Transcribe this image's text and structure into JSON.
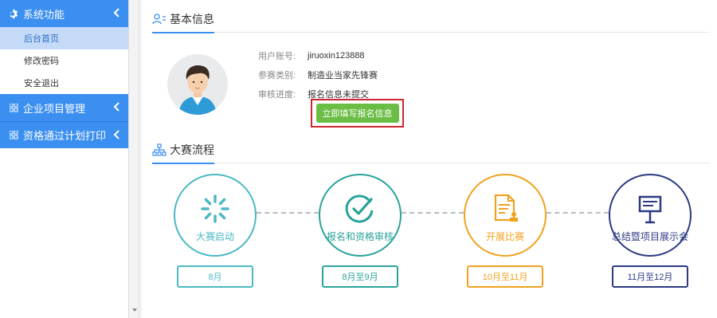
{
  "sidebar": {
    "groups": [
      {
        "label": "系统功能",
        "icon": "gear-icon",
        "items": [
          {
            "label": "后台首页",
            "active": true
          },
          {
            "label": "修改密码",
            "active": false
          },
          {
            "label": "安全退出",
            "active": false
          }
        ]
      },
      {
        "label": "企业项目管理",
        "icon": "grid-icon",
        "items": []
      },
      {
        "label": "资格通过计划打印",
        "icon": "grid-icon",
        "items": []
      }
    ]
  },
  "basic_info": {
    "title": "基本信息",
    "fields": [
      {
        "label": "用户账号:",
        "value": "jiruoxin123888"
      },
      {
        "label": "参赛类别:",
        "value": "制造业当家先锋赛"
      },
      {
        "label": "审核进度:",
        "value": "报名信息未提交"
      }
    ],
    "fill_button": "立即填写报名信息"
  },
  "process": {
    "title": "大赛流程",
    "stages": [
      {
        "label": "大赛启动",
        "date": "8月",
        "icon": "loading-icon",
        "color": "#4cb8c4"
      },
      {
        "label": "报名和资格审核",
        "date": "8月至9月",
        "icon": "check-circle-icon",
        "color": "#2aa39a"
      },
      {
        "label": "开展比赛",
        "date": "10月至11月",
        "icon": "document-stamp-icon",
        "color": "#f0a21f"
      },
      {
        "label": "总结暨项目展示会",
        "date": "11月至12月",
        "icon": "signboard-icon",
        "color": "#2b3a82"
      }
    ]
  }
}
